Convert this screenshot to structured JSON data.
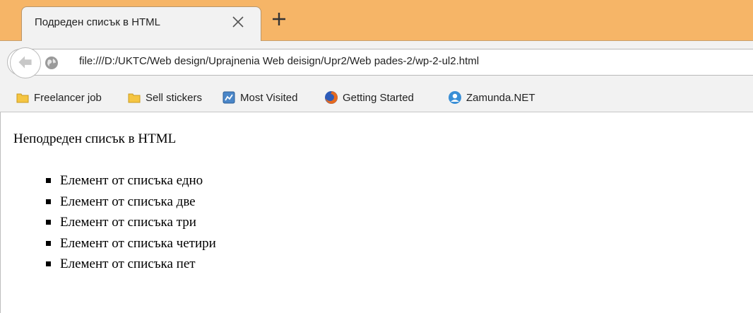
{
  "tab": {
    "title": "Подреден списък в HTML"
  },
  "navbar": {
    "url": "file:///D:/UKTC/Web design/Uprajnenia Web deisign/Upr2/Web pades-2/wp-2-ul2.html"
  },
  "bookmarks": [
    {
      "label": "Freelancer job",
      "icon": "folder-icon"
    },
    {
      "label": "Sell stickers",
      "icon": "folder-icon"
    },
    {
      "label": "Most Visited",
      "icon": "most-visited-icon"
    },
    {
      "label": "Getting Started",
      "icon": "firefox-icon"
    },
    {
      "label": "Zamunda.NET",
      "icon": "zamunda-icon"
    }
  ],
  "content": {
    "heading": "Неподреден списък в HTML",
    "items": [
      "Елемент от списъка едно",
      "Елемент от списъка две",
      "Елемент от списъка три",
      "Елемент от списъка четири",
      "Елемент от списъка пет"
    ]
  },
  "colors": {
    "tabstrip": "#f6b567",
    "toolbar": "#f2f2f2",
    "text": "#222222"
  }
}
